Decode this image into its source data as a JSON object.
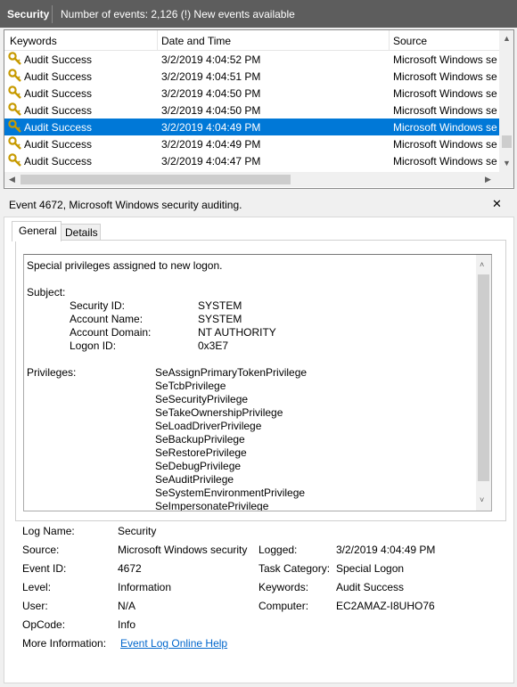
{
  "header": {
    "title": "Security",
    "info": "Number of events: 2,126 (!) New events available"
  },
  "list": {
    "columns": [
      "Keywords",
      "Date and Time",
      "Source"
    ],
    "rows": [
      {
        "keyword": "Audit Success",
        "date": "3/2/2019 4:04:52 PM",
        "source": "Microsoft Windows se"
      },
      {
        "keyword": "Audit Success",
        "date": "3/2/2019 4:04:51 PM",
        "source": "Microsoft Windows se"
      },
      {
        "keyword": "Audit Success",
        "date": "3/2/2019 4:04:50 PM",
        "source": "Microsoft Windows se"
      },
      {
        "keyword": "Audit Success",
        "date": "3/2/2019 4:04:50 PM",
        "source": "Microsoft Windows se"
      },
      {
        "keyword": "Audit Success",
        "date": "3/2/2019 4:04:49 PM",
        "source": "Microsoft Windows se"
      },
      {
        "keyword": "Audit Success",
        "date": "3/2/2019 4:04:49 PM",
        "source": "Microsoft Windows se"
      },
      {
        "keyword": "Audit Success",
        "date": "3/2/2019 4:04:47 PM",
        "source": "Microsoft Windows se"
      }
    ],
    "selected_index": 4
  },
  "detail": {
    "title": "Event 4672, Microsoft Windows security auditing.",
    "close_symbol": "✕",
    "tabs": [
      "General",
      "Details"
    ],
    "active_tab": "General",
    "description": {
      "heading": "Special privileges assigned to new logon.",
      "subject_label": "Subject:",
      "subject_fields": [
        {
          "label": "Security ID:",
          "value": "SYSTEM"
        },
        {
          "label": "Account Name:",
          "value": "SYSTEM"
        },
        {
          "label": "Account Domain:",
          "value": "NT AUTHORITY"
        },
        {
          "label": "Logon ID:",
          "value": "0x3E7"
        }
      ],
      "privileges_label": "Privileges:",
      "privileges": [
        "SeAssignPrimaryTokenPrivilege",
        "SeTcbPrivilege",
        "SeSecurityPrivilege",
        "SeTakeOwnershipPrivilege",
        "SeLoadDriverPrivilege",
        "SeBackupPrivilege",
        "SeRestorePrivilege",
        "SeDebugPrivilege",
        "SeAuditPrivilege",
        "SeSystemEnvironmentPrivilege",
        "SeImpersonatePrivilege"
      ]
    },
    "fields_left": [
      {
        "label": "Log Name:",
        "value": "Security"
      },
      {
        "label": "Source:",
        "value": "Microsoft Windows security"
      },
      {
        "label": "Event ID:",
        "value": "4672"
      },
      {
        "label": "Level:",
        "value": "Information"
      },
      {
        "label": "User:",
        "value": "N/A"
      },
      {
        "label": "OpCode:",
        "value": "Info"
      },
      {
        "label": "More Information:",
        "value": "Event Log Online Help"
      }
    ],
    "fields_right": [
      {
        "label": "Logged:",
        "value": "3/2/2019 4:04:49 PM"
      },
      {
        "label": "Task Category:",
        "value": "Special Logon"
      },
      {
        "label": "Keywords:",
        "value": "Audit Success"
      },
      {
        "label": "Computer:",
        "value": "EC2AMAZ-I8UHO76"
      }
    ]
  },
  "colors": {
    "header_bg": "#5d5d5d",
    "selection": "#0078d7",
    "link": "#0066cc"
  }
}
